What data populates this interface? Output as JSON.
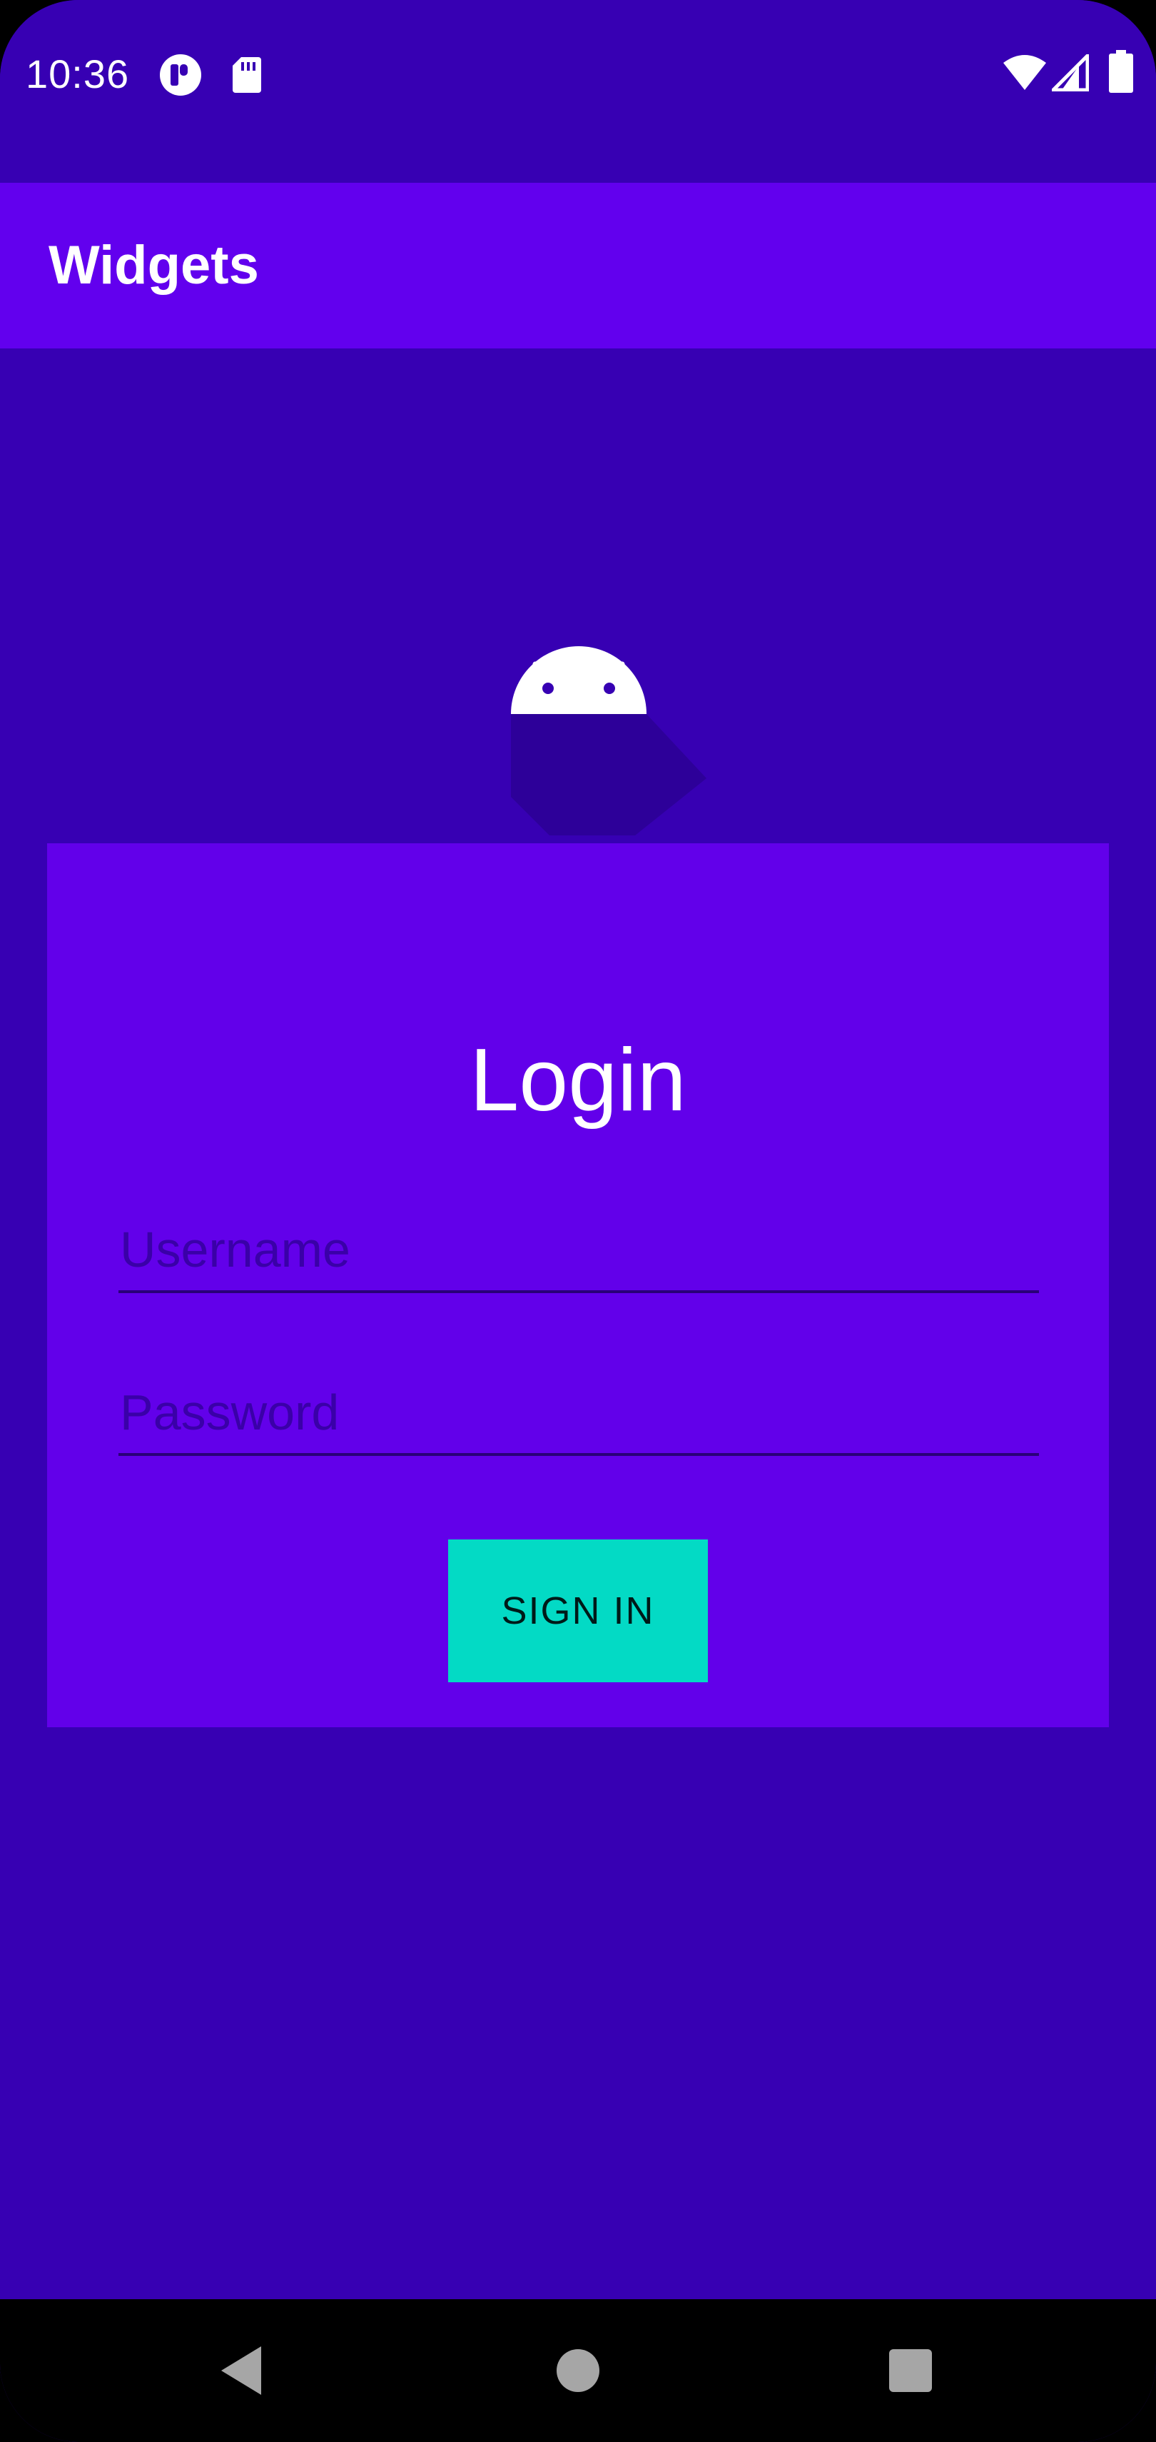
{
  "status_bar": {
    "time": "10:36",
    "icons_left": [
      "app-notification-icon",
      "sd-card-icon"
    ],
    "icons_right": [
      "wifi-icon",
      "cell-signal-icon",
      "battery-icon"
    ]
  },
  "app_bar": {
    "title": "Widgets"
  },
  "logo": {
    "icon": "android-logo-icon"
  },
  "login": {
    "title": "Login",
    "username_placeholder": "Username",
    "username_value": "",
    "password_placeholder": "Password",
    "password_value": "",
    "sign_in_label": "SIGN IN"
  },
  "nav_bar": {
    "icons": [
      "back-icon",
      "home-icon",
      "recents-icon"
    ]
  },
  "colors": {
    "background": "#3700b3",
    "app_bar": "#6200ee",
    "card": "#6200ea",
    "accent": "#03dac5",
    "nav_bar": "#000000"
  }
}
